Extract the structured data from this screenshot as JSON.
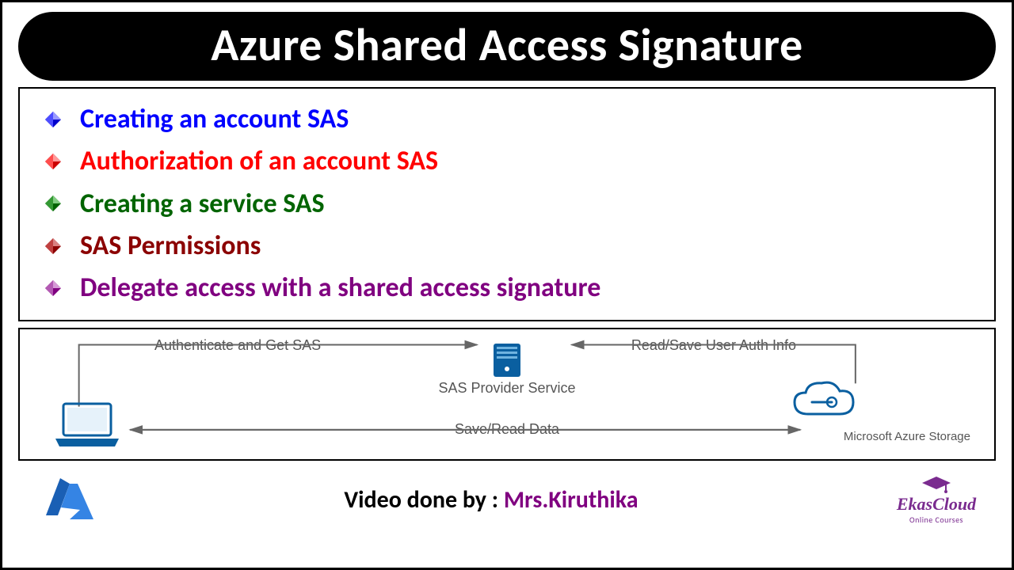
{
  "title": "Azure Shared Access Signature",
  "bullets": [
    {
      "text": "Creating an account SAS",
      "color": "c-blue",
      "icon_fill": "#0000cc"
    },
    {
      "text": "Authorization of an account SAS",
      "color": "c-red",
      "icon_fill": "#cc0000"
    },
    {
      "text": "Creating a service SAS",
      "color": "c-green",
      "icon_fill": "#008000"
    },
    {
      "text": "SAS Permissions",
      "color": "c-darkred",
      "icon_fill": "#8b0000"
    },
    {
      "text": "Delegate access with a shared access signature",
      "color": "c-purple",
      "icon_fill": "#800080"
    }
  ],
  "diagram": {
    "label_auth": "Authenticate and Get SAS",
    "label_provider": "SAS Provider Service",
    "label_read_user": "Read/Save User Auth Info",
    "label_save_read": "Save/Read Data",
    "label_storage": "Microsoft Azure Storage"
  },
  "credit_prefix": "Video done by : ",
  "credit_author": "Mrs.Kiruthika",
  "logo_brand": "EkasCloud",
  "logo_tag": "Online Courses"
}
